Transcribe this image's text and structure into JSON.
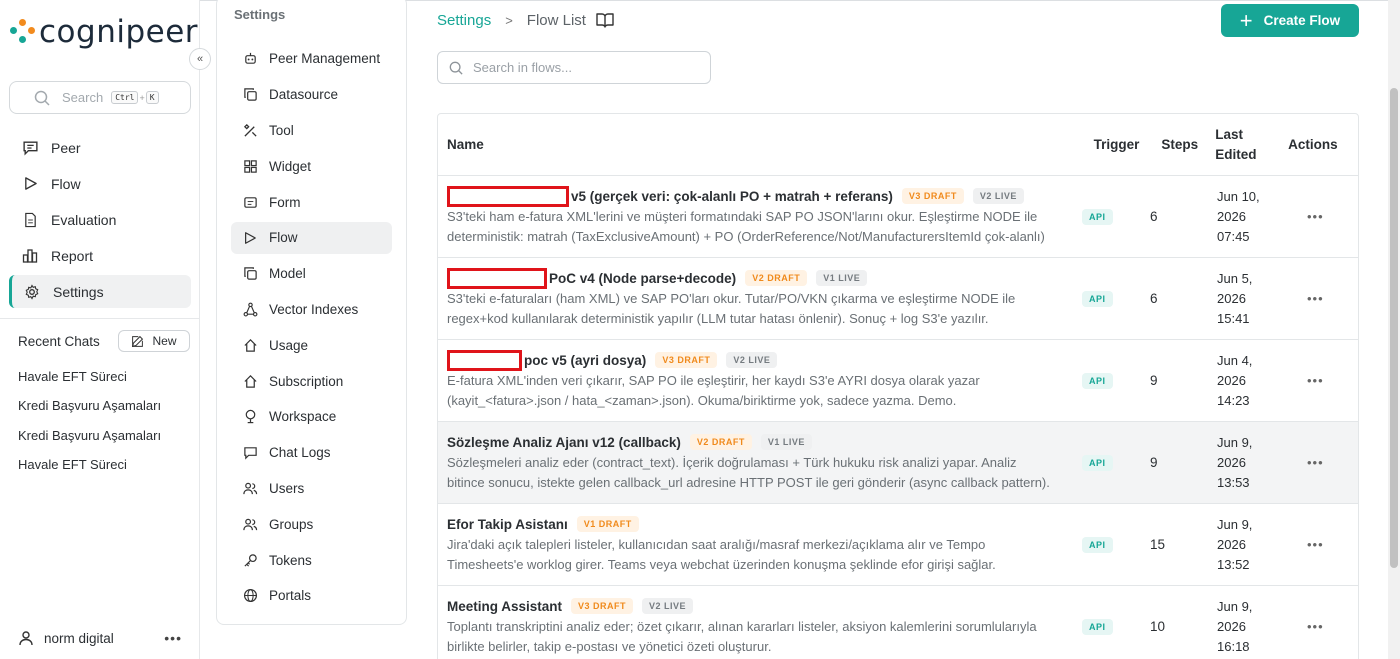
{
  "app": {
    "logo_text": "cognipeer",
    "search_placeholder": "Search",
    "shortcut_ctrl": "Ctrl",
    "shortcut_plus": "+",
    "shortcut_key": "K",
    "accent": "#17a696"
  },
  "main_nav": [
    {
      "label": "Peer",
      "icon": "chat-bubble-icon"
    },
    {
      "label": "Flow",
      "icon": "play-icon"
    },
    {
      "label": "Evaluation",
      "icon": "document-icon"
    },
    {
      "label": "Report",
      "icon": "bar-chart-icon"
    },
    {
      "label": "Settings",
      "icon": "gear-icon",
      "active": true
    }
  ],
  "recent": {
    "title": "Recent Chats",
    "new_label": "New",
    "chats": [
      "Havale EFT Süreci",
      "Kredi Başvuru Aşamaları",
      "Kredi Başvuru Aşamaları",
      "Havale EFT Süreci"
    ]
  },
  "user": {
    "name": "norm digital"
  },
  "settings": {
    "title": "Settings",
    "items": [
      {
        "label": "Peer Management",
        "icon": "robot-icon"
      },
      {
        "label": "Datasource",
        "icon": "copy-icon"
      },
      {
        "label": "Tool",
        "icon": "tools-icon"
      },
      {
        "label": "Widget",
        "icon": "widget-grid-icon"
      },
      {
        "label": "Form",
        "icon": "form-icon"
      },
      {
        "label": "Flow",
        "icon": "play-icon",
        "active": true
      },
      {
        "label": "Model",
        "icon": "copy-icon"
      },
      {
        "label": "Vector Indexes",
        "icon": "vector-nodes-icon"
      },
      {
        "label": "Usage",
        "icon": "home-icon"
      },
      {
        "label": "Subscription",
        "icon": "home-icon"
      },
      {
        "label": "Workspace",
        "icon": "globe-stand-icon"
      },
      {
        "label": "Chat Logs",
        "icon": "chat-bubble-icon"
      },
      {
        "label": "Users",
        "icon": "users-icon"
      },
      {
        "label": "Groups",
        "icon": "users-icon"
      },
      {
        "label": "Tokens",
        "icon": "key-icon"
      },
      {
        "label": "Portals",
        "icon": "globe-icon"
      }
    ]
  },
  "breadcrumb": {
    "root": "Settings",
    "current": "Flow List"
  },
  "create_button": "Create Flow",
  "flow_search_placeholder": "Search in flows...",
  "table": {
    "headers": {
      "name": "Name",
      "trigger": "Trigger",
      "steps": "Steps",
      "edited_1": "Last",
      "edited_2": "Edited",
      "actions": "Actions"
    },
    "rows": [
      {
        "title": "v5 (gerçek veri: çok-alanlı PO + matrah + referans)",
        "draft": "V3 DRAFT",
        "live": "V2 LIVE",
        "desc1": "S3'teki ham e-fatura XML'lerini ve müşteri formatındaki SAP PO JSON'larını okur. Eşleştirme NODE ile",
        "desc2": "deterministik: matrah (TaxExclusiveAmount) + PO (OrderReference/Not/ManufacturersItemId çok-alanlı)",
        "trigger": "API",
        "steps": "6",
        "date1": "Jun 10,",
        "date2": "2026",
        "date3": "07:45"
      },
      {
        "title": "PoC v4 (Node parse+decode)",
        "draft": "V2 DRAFT",
        "live": "V1 LIVE",
        "desc1": "S3'teki e-faturaları (ham XML) ve SAP PO'ları okur. Tutar/PO/VKN çıkarma ve eşleştirme NODE ile",
        "desc2": "regex+kod kullanılarak deterministik yapılır (LLM tutar hatası önlenir). Sonuç + log S3'e yazılır.",
        "trigger": "API",
        "steps": "6",
        "date1": "Jun 5,",
        "date2": "2026",
        "date3": "15:41"
      },
      {
        "title": "poc v5 (ayri dosya)",
        "draft": "V3 DRAFT",
        "live": "V2 LIVE",
        "desc1": "E-fatura XML'inden veri çıkarır, SAP PO ile eşleştirir, her kaydı S3'e AYRI dosya olarak yazar",
        "desc2": "(kayit_<fatura>.json / hata_<zaman>.json). Okuma/biriktirme yok, sadece yazma. Demo.",
        "trigger": "API",
        "steps": "9",
        "date1": "Jun 4,",
        "date2": "2026",
        "date3": "14:23"
      },
      {
        "title": "Sözleşme Analiz Ajanı v12 (callback)",
        "draft": "V2 DRAFT",
        "live": "V1 LIVE",
        "desc1": "Sözleşmeleri analiz eder (contract_text). İçerik doğrulaması + Türk hukuku risk analizi yapar. Analiz",
        "desc2": "bitince sonucu, istekte gelen callback_url adresine HTTP POST ile geri gönderir (async callback pattern).",
        "trigger": "API",
        "steps": "9",
        "date1": "Jun 9,",
        "date2": "2026",
        "date3": "13:53"
      },
      {
        "title": "Efor Takip Asistanı",
        "draft": "V1 DRAFT",
        "live": "",
        "desc1": "Jira'daki açık talepleri listeler, kullanıcıdan saat aralığı/masraf merkezi/açıklama alır ve Tempo",
        "desc2": "Timesheets'e worklog girer. Teams veya webchat üzerinden konuşma şeklinde efor girişi sağlar.",
        "trigger": "API",
        "steps": "15",
        "date1": "Jun 9,",
        "date2": "2026",
        "date3": "13:52"
      },
      {
        "title": "Meeting Assistant",
        "draft": "V3 DRAFT",
        "live": "V2 LIVE",
        "desc1": "Toplantı transkriptini analiz eder; özet çıkarır, alınan kararları listeler, aksiyon kalemlerini sorumlularıyla",
        "desc2": "birlikte belirler, takip e-postası ve yönetici özeti oluşturur.",
        "trigger": "API",
        "steps": "10",
        "date1": "Jun 9,",
        "date2": "2026",
        "date3": "16:18"
      }
    ]
  }
}
